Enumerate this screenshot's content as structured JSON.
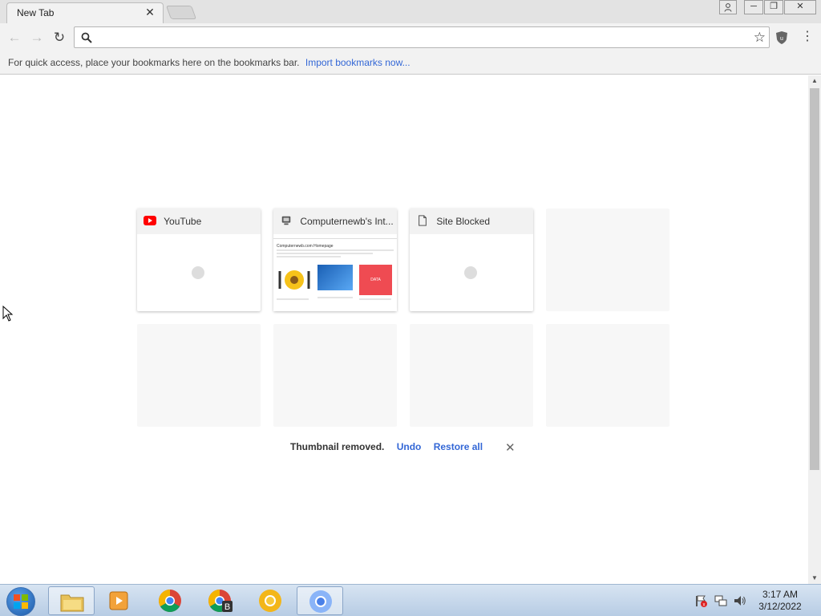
{
  "tab": {
    "title": "New Tab",
    "close": "✕"
  },
  "window": {
    "minimize": "─",
    "maximize": "❐",
    "close": "✕"
  },
  "toolbar": {
    "back": "←",
    "forward": "→",
    "reload": "↻",
    "search_placeholder": "",
    "star": "☆",
    "menu": "⋮"
  },
  "bookmarks": {
    "message": "For quick access, place your bookmarks here on the bookmarks bar.",
    "import_link": "Import bookmarks now..."
  },
  "tiles": [
    {
      "title": "YouTube",
      "icon": "youtube-icon"
    },
    {
      "title": "Computernewb's Int...",
      "icon": "computernewb-icon"
    },
    {
      "title": "Site Blocked",
      "icon": "page-icon"
    }
  ],
  "thumbnail_preview": {
    "heading": "Computernewb.com Homepage",
    "badge": "DATA"
  },
  "notice": {
    "message": "Thumbnail removed.",
    "undo": "Undo",
    "restore": "Restore all",
    "close": "✕"
  },
  "taskbar": {
    "time": "3:17 AM",
    "date": "3/12/2022",
    "badge": "B"
  },
  "colors": {
    "accent": "#3367d6",
    "youtube": "#ff0000"
  }
}
